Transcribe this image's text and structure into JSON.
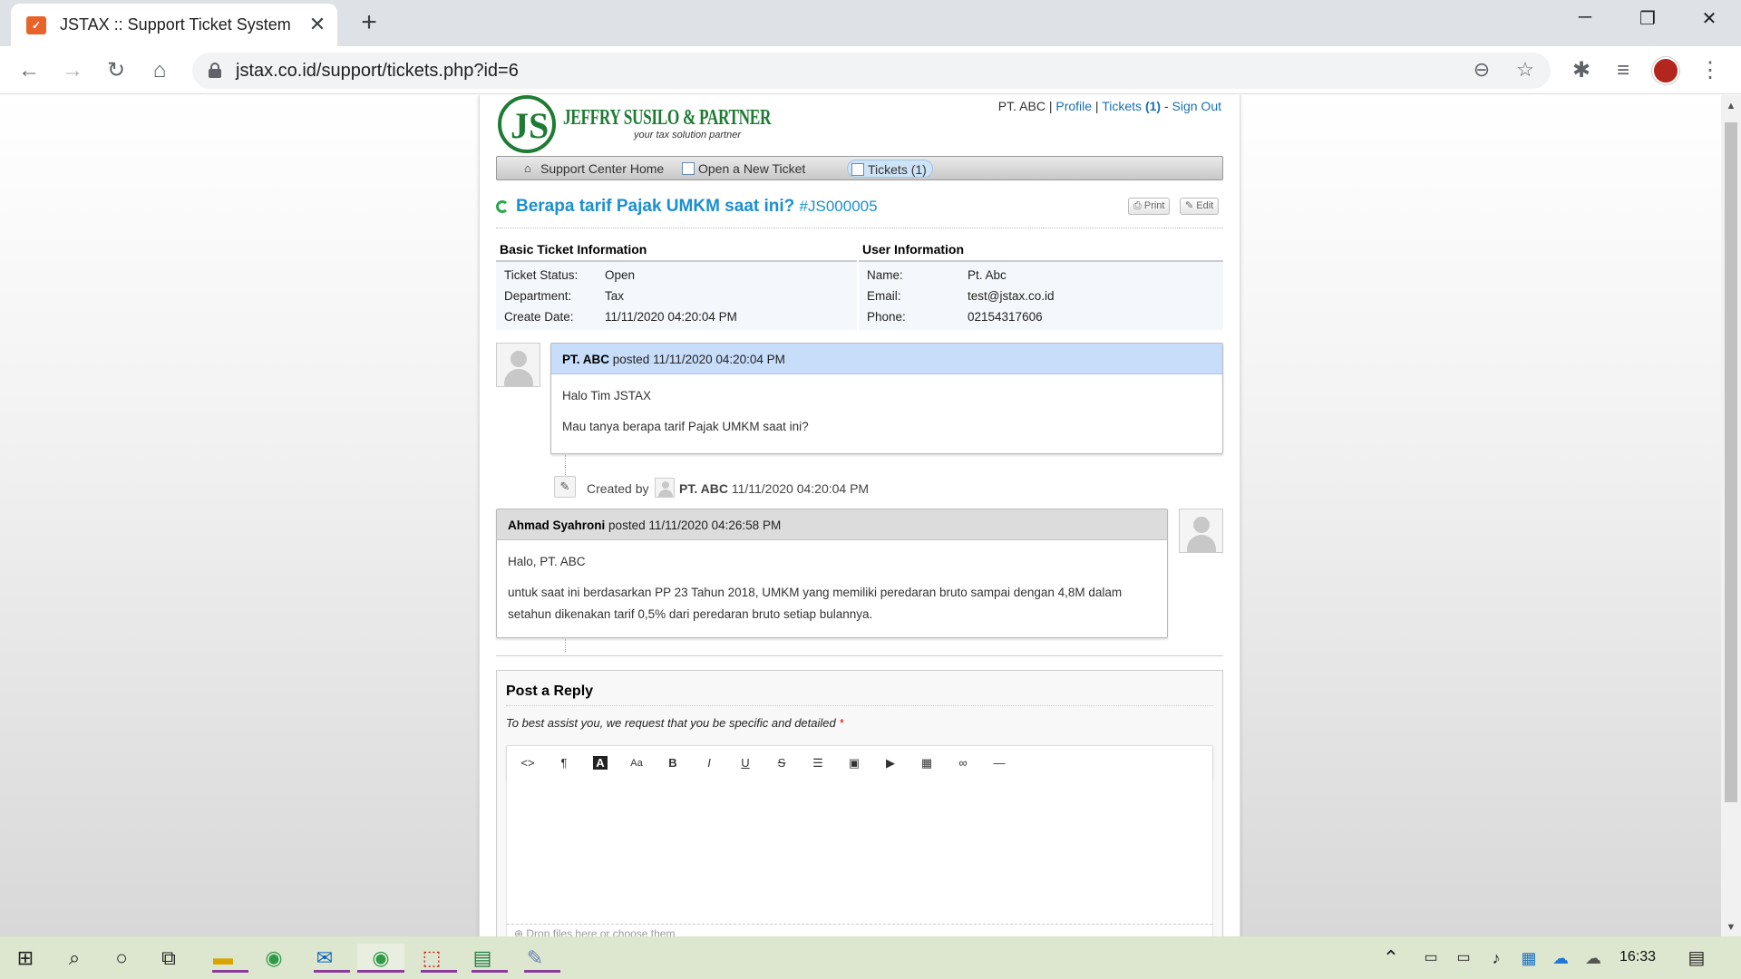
{
  "browser": {
    "tab_title": "JSTAX :: Support Ticket System",
    "favicon_text": "✓",
    "url": "jstax.co.id/support/tickets.php?id=6"
  },
  "site": {
    "logo_mark": "JS",
    "logo_name": "JEFFRY SUSILO & PARTNER",
    "logo_tagline": "your tax solution partner",
    "user_name": "PT. ABC",
    "profile_link": "Profile",
    "tickets_link": "Tickets",
    "tickets_count": "(1)",
    "signout_link": "Sign Out"
  },
  "menu": [
    {
      "label": "Support Center Home",
      "icon": "home-icon"
    },
    {
      "label": "Open a New Ticket",
      "icon": "new-ticket-icon"
    },
    {
      "label": "Tickets (1)",
      "icon": "tickets-icon"
    }
  ],
  "ticket": {
    "subject": "Berapa tarif Pajak UMKM saat ini?",
    "number": "#JS000005",
    "print_label": "Print",
    "edit_label": "Edit"
  },
  "basic_info": {
    "heading": "Basic Ticket Information",
    "rows": [
      {
        "key": "Ticket Status:",
        "value": "Open"
      },
      {
        "key": "Department:",
        "value": "Tax"
      },
      {
        "key": "Create Date:",
        "value": "11/11/2020 04:20:04 PM"
      }
    ]
  },
  "user_info": {
    "heading": "User Information",
    "rows": [
      {
        "key": "Name:",
        "value": "Pt. Abc"
      },
      {
        "key": "Email:",
        "value": "test@jstax.co.id"
      },
      {
        "key": "Phone:",
        "value": "02154317606"
      }
    ]
  },
  "thread": [
    {
      "author": "PT. ABC",
      "posted": "posted 11/11/2020 04:20:04 PM",
      "lines": [
        "Halo Tim JSTAX",
        "Mau tanya berapa tarif Pajak UMKM saat ini?"
      ],
      "header_color": "#c7ddfa"
    },
    {
      "author": "Ahmad Syahroni",
      "posted": "posted 11/11/2020 04:26:58 PM",
      "lines": [
        "Halo, PT. ABC",
        "untuk saat ini berdasarkan PP 23 Tahun 2018, UMKM yang memiliki peredaran bruto sampai dengan 4,8M dalam setahun dikenakan tarif 0,5% dari peredaran bruto setiap bulannya."
      ],
      "header_color": "#dcdcdc"
    }
  ],
  "event": {
    "prefix": "Created by",
    "author": "PT. ABC",
    "time": "11/11/2020 04:20:04 PM"
  },
  "reply": {
    "title": "Post a Reply",
    "hint": "To best assist you, we request that you be specific and detailed",
    "required_mark": "*",
    "dropzone": "Drop files here or choose them"
  },
  "taskbar": {
    "clock": "16:33"
  }
}
